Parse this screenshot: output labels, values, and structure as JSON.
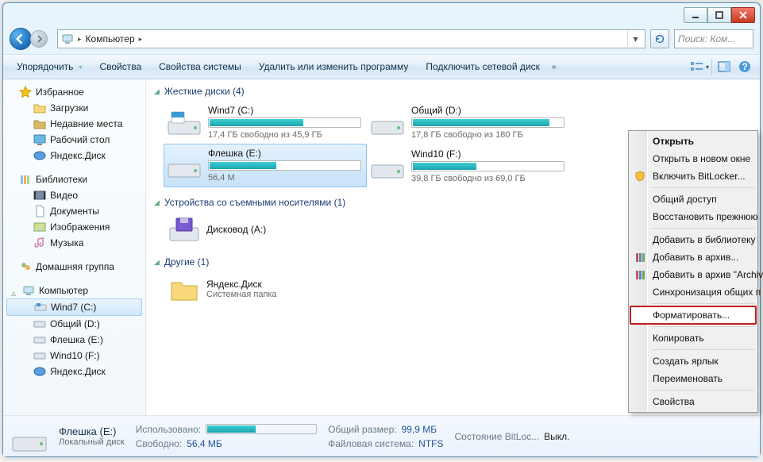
{
  "breadcrumb": {
    "root_sep": "▸",
    "location": "Компьютер",
    "sep": "▸"
  },
  "search": {
    "placeholder": "Поиск: Ком..."
  },
  "toolbar": {
    "organize": "Упорядочить",
    "properties": "Свойства",
    "sys_properties": "Свойства системы",
    "uninstall": "Удалить или изменить программу",
    "map_drive": "Подключить сетевой диск",
    "overflow": "»"
  },
  "sidebar": {
    "favorites": {
      "label": "Избранное",
      "items": [
        {
          "label": "Загрузки"
        },
        {
          "label": "Недавние места"
        },
        {
          "label": "Рабочий стол"
        },
        {
          "label": "Яндекс.Диск"
        }
      ]
    },
    "libraries": {
      "label": "Библиотеки",
      "items": [
        {
          "label": "Видео"
        },
        {
          "label": "Документы"
        },
        {
          "label": "Изображения"
        },
        {
          "label": "Музыка"
        }
      ]
    },
    "homegroup": {
      "label": "Домашняя группа"
    },
    "computer": {
      "label": "Компьютер",
      "items": [
        {
          "label": "Wind7 (C:)"
        },
        {
          "label": "Общий (D:)"
        },
        {
          "label": "Флешка (E:)"
        },
        {
          "label": "Wind10 (F:)"
        },
        {
          "label": "Яндекс.Диск"
        }
      ]
    }
  },
  "sections": {
    "hdd": {
      "title": "Жесткие диски (4)"
    },
    "removable": {
      "title": "Устройства со съемными носителями (1)"
    },
    "other": {
      "title": "Другие (1)"
    }
  },
  "drives": {
    "c": {
      "name": "Wind7 (C:)",
      "sub": "17,4 ГБ свободно из 45,9 ГБ",
      "fill": 62
    },
    "d": {
      "name": "Общий (D:)",
      "sub": "17,8 ГБ свободно из 180 ГБ",
      "fill": 90
    },
    "e": {
      "name": "Флешка (E:)",
      "sub": "56,4 М",
      "fill": 44,
      "selected": true
    },
    "f": {
      "name": "Wind10 (F:)",
      "sub": "39,8 ГБ свободно из 69,0 ГБ",
      "fill": 42
    }
  },
  "removable": {
    "a": {
      "name": "Дисковод (A:)"
    }
  },
  "other": {
    "ydisk": {
      "name": "Яндекс.Диск",
      "sub": "Системная папка"
    }
  },
  "details": {
    "name": "Флешка (E:)",
    "type": "Локальный диск",
    "used_k": "Использовано:",
    "free_k": "Свободно:",
    "free_v": "56,4 МБ",
    "total_k": "Общий размер:",
    "total_v": "99,9 МБ",
    "fs_k": "Файловая система:",
    "fs_v": "NTFS",
    "bl_k": "Состояние BitLoc...",
    "bl_v": "Выкл."
  },
  "ctx": {
    "open": "Открыть",
    "open_new": "Открыть в новом окне",
    "bitlocker": "Включить BitLocker...",
    "share": "Общий доступ",
    "restore": "Восстановить прежнюю",
    "add_lib": "Добавить в библиотеку",
    "add_arch": "Добавить в архив...",
    "add_arch_name": "Добавить в архив \"Archiv",
    "sync": "Синхронизация общих п",
    "format": "Форматировать...",
    "copy": "Копировать",
    "shortcut": "Создать ярлык",
    "rename": "Переименовать",
    "props": "Свойства"
  }
}
